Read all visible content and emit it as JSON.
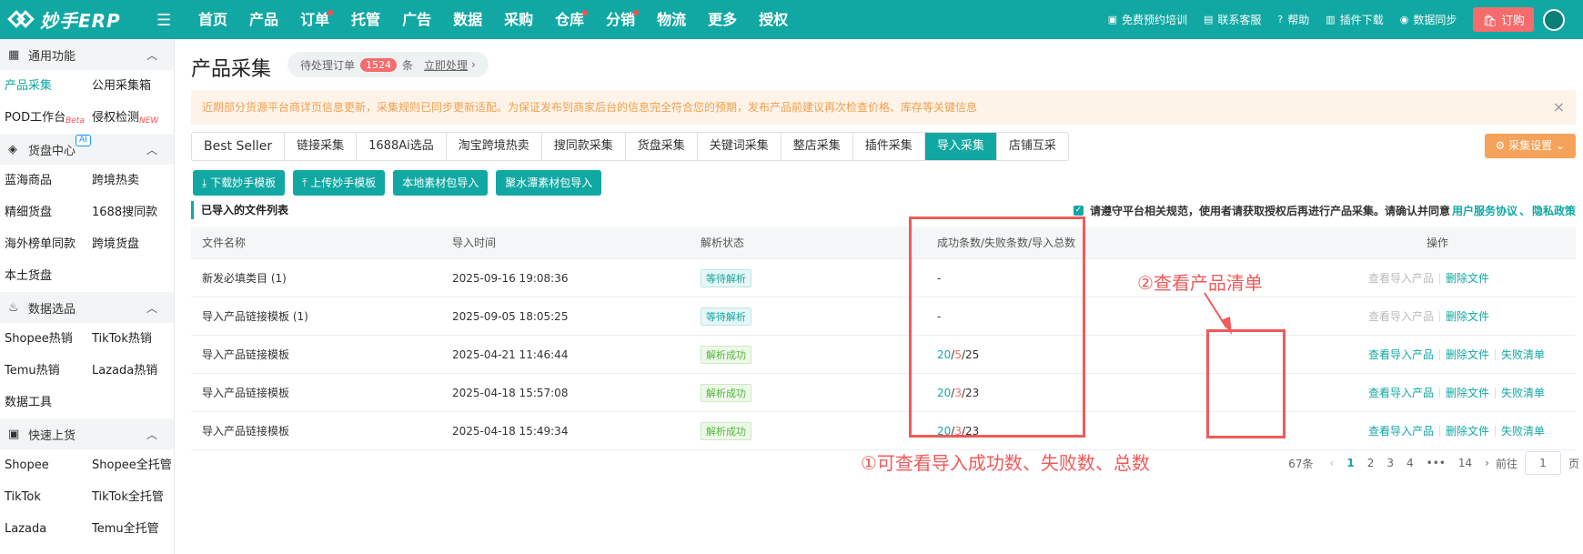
{
  "header": {
    "logo_text": "妙手ERP",
    "nav": [
      {
        "label": "首页",
        "dot": false
      },
      {
        "label": "产品",
        "dot": false
      },
      {
        "label": "订单",
        "dot": true
      },
      {
        "label": "托管",
        "dot": false
      },
      {
        "label": "广告",
        "dot": false
      },
      {
        "label": "数据",
        "dot": false
      },
      {
        "label": "采购",
        "dot": false
      },
      {
        "label": "仓库",
        "dot": true
      },
      {
        "label": "分销",
        "dot": true
      },
      {
        "label": "物流",
        "dot": false
      },
      {
        "label": "更多",
        "dot": false
      },
      {
        "label": "授权",
        "dot": false
      }
    ],
    "tools": [
      {
        "icon": "chat-icon",
        "label": "免费预约培训"
      },
      {
        "icon": "service-icon",
        "label": "联系客服"
      },
      {
        "icon": "help-icon",
        "label": "帮助"
      },
      {
        "icon": "download-icon",
        "label": "插件下载"
      },
      {
        "icon": "sync-icon",
        "label": "数据同步"
      }
    ],
    "order_label": "订购"
  },
  "sidebar": {
    "sections": [
      {
        "title": "通用功能",
        "icon": "grid-icon",
        "items": [
          {
            "label": "产品采集",
            "active": true,
            "sup": ""
          },
          {
            "label": "公用采集箱",
            "active": false,
            "sup": ""
          },
          {
            "label": "POD工作台",
            "active": false,
            "sup": "Beta"
          },
          {
            "label": "侵权检测",
            "active": false,
            "sup": "NEW"
          }
        ]
      },
      {
        "title": "货盘中心",
        "icon": "box-icon",
        "items": [
          {
            "label": "蓝海商品",
            "active": false,
            "sup": ""
          },
          {
            "label": "跨境热卖",
            "active": false,
            "sup": ""
          },
          {
            "label": "精细货盘",
            "active": false,
            "sup": ""
          },
          {
            "label": "1688搜同款",
            "active": false,
            "sup": ""
          },
          {
            "label": "海外榜单同款",
            "active": false,
            "sup": ""
          },
          {
            "label": "跨境货盘",
            "active": false,
            "sup": ""
          },
          {
            "label": "本土货盘",
            "active": false,
            "sup": ""
          }
        ]
      },
      {
        "title": "数据选品",
        "icon": "fire-icon",
        "items": [
          {
            "label": "Shopee热销",
            "active": false,
            "sup": ""
          },
          {
            "label": "TikTok热销",
            "active": false,
            "sup": ""
          },
          {
            "label": "Temu热销",
            "active": false,
            "sup": ""
          },
          {
            "label": "Lazada热销",
            "active": false,
            "sup": ""
          },
          {
            "label": "数据工具",
            "active": false,
            "sup": ""
          }
        ]
      },
      {
        "title": "快速上货",
        "icon": "bag-icon",
        "items": [
          {
            "label": "Shopee",
            "active": false,
            "sup": ""
          },
          {
            "label": "Shopee全托管",
            "active": false,
            "sup": ""
          },
          {
            "label": "TikTok",
            "active": false,
            "sup": ""
          },
          {
            "label": "TikTok全托管",
            "active": false,
            "sup": ""
          },
          {
            "label": "Lazada",
            "active": false,
            "sup": ""
          },
          {
            "label": "Temu全托管",
            "active": false,
            "sup": ""
          }
        ]
      }
    ],
    "ai_badge": "AI"
  },
  "main": {
    "title": "产品采集",
    "pending": {
      "label": "待处理订单",
      "count": "1524",
      "unit": "条",
      "action": "立即处理"
    },
    "notice": "近期部分货源平台商详页信息更新，采集规则已同步更新适配。为保证发布到商家后台的信息完全符合您的预期，发布产品前建议再次检查价格、库存等关键信息",
    "tabs": [
      "Best Seller",
      "链接采集",
      "1688Ai选品",
      "淘宝跨境热卖",
      "搜同款采集",
      "货盘采集",
      "关键词采集",
      "整店采集",
      "插件采集",
      "导入采集",
      "店铺互采"
    ],
    "active_tab": 9,
    "settings_label": "采集设置",
    "action_buttons": [
      "下载妙手模板",
      "上传妙手模板",
      "本地素材包导入",
      "聚水潭素材包导入"
    ],
    "list_title": "已导入的文件列表",
    "agree_text": "请遵守平台相关规范，使用者请获取授权后再进行产品采集。请确认并同意",
    "agree_links": [
      "用户服务协议",
      "、",
      "隐私政策"
    ],
    "table": {
      "headers": [
        "文件名称",
        "导入时间",
        "解析状态",
        "成功条数/失败条数/导入总数",
        "操作"
      ],
      "rows": [
        {
          "name": "新发必填类目 (1)",
          "time": "2025-09-16 19:08:36",
          "status": "等待解析",
          "status_type": "wait",
          "counts": null,
          "dash": "-",
          "ops": [
            {
              "label": "查看导入产品",
              "disabled": true
            },
            {
              "label": "删除文件",
              "disabled": false
            }
          ]
        },
        {
          "name": "导入产品链接模板 (1)",
          "time": "2025-09-05 18:05:25",
          "status": "等待解析",
          "status_type": "wait",
          "counts": null,
          "dash": "-",
          "ops": [
            {
              "label": "查看导入产品",
              "disabled": true
            },
            {
              "label": "删除文件",
              "disabled": false
            }
          ]
        },
        {
          "name": "导入产品链接模板",
          "time": "2025-04-21 11:46:44",
          "status": "解析成功",
          "status_type": "ok",
          "counts": {
            "success": "20",
            "fail": "5",
            "total": "25"
          },
          "ops": [
            {
              "label": "查看导入产品",
              "disabled": false
            },
            {
              "label": "删除文件",
              "disabled": false
            },
            {
              "label": "失败清单",
              "disabled": false
            }
          ]
        },
        {
          "name": "导入产品链接模板",
          "time": "2025-04-18 15:57:08",
          "status": "解析成功",
          "status_type": "ok",
          "counts": {
            "success": "20",
            "fail": "3",
            "total": "23"
          },
          "ops": [
            {
              "label": "查看导入产品",
              "disabled": false
            },
            {
              "label": "删除文件",
              "disabled": false
            },
            {
              "label": "失败清单",
              "disabled": false
            }
          ]
        },
        {
          "name": "导入产品链接模板",
          "time": "2025-04-18 15:49:34",
          "status": "解析成功",
          "status_type": "ok",
          "counts": {
            "success": "20",
            "fail": "3",
            "total": "23"
          },
          "ops": [
            {
              "label": "查看导入产品",
              "disabled": false
            },
            {
              "label": "删除文件",
              "disabled": false
            },
            {
              "label": "失败清单",
              "disabled": false
            }
          ]
        }
      ]
    },
    "annotations": {
      "note1": "①可查看导入成功数、失败数、总数",
      "note2": "②查看产品清单"
    },
    "pager": {
      "total": "67条",
      "pages": [
        "1",
        "2",
        "3",
        "4",
        "•••",
        "14"
      ],
      "current": "1",
      "goto_label": "前往",
      "goto_value": "1",
      "page_unit": "页"
    }
  }
}
